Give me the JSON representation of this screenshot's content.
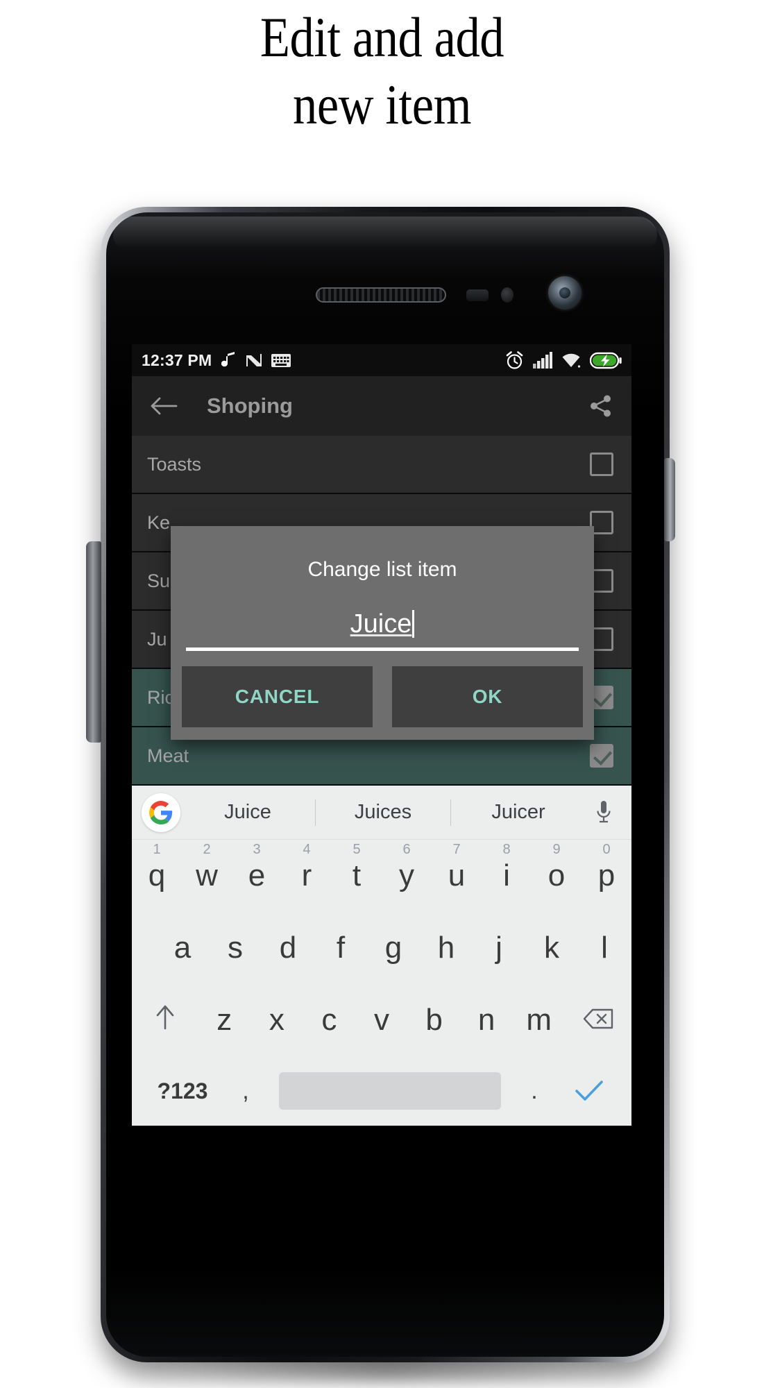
{
  "heading": {
    "line1": "Edit and add",
    "line2": "new item"
  },
  "status_bar": {
    "time": "12:37 PM",
    "left_icons": [
      "music-note-icon",
      "nougat-n-icon",
      "keyboard-icon"
    ],
    "right_icons": [
      "alarm-icon",
      "signal-bars-icon",
      "wifi-icon",
      "battery-charging-icon"
    ],
    "battery_color": "#3ea62b"
  },
  "app_bar": {
    "back_icon": "back-arrow-icon",
    "title": "Shoping",
    "share_icon": "share-icon"
  },
  "list": {
    "rows": [
      {
        "label": "Toasts",
        "checked": false,
        "done": false
      },
      {
        "label": "Ke",
        "checked": false,
        "done": false
      },
      {
        "label": "Su",
        "checked": false,
        "done": false
      },
      {
        "label": "Ju",
        "checked": false,
        "done": false
      },
      {
        "label": "Rice",
        "checked": true,
        "done": true
      },
      {
        "label": "Meat",
        "checked": true,
        "done": true
      }
    ]
  },
  "dialog": {
    "title": "Change list item",
    "input_value": "Juice",
    "cancel_label": "CANCEL",
    "ok_label": "OK",
    "accent_color": "#8fd7c4"
  },
  "keyboard": {
    "suggestions": [
      "Juice",
      "Juices",
      "Juicer"
    ],
    "google_icon": "google-g-icon",
    "mic_icon": "microphone-icon",
    "row1": [
      {
        "k": "q",
        "n": "1"
      },
      {
        "k": "w",
        "n": "2"
      },
      {
        "k": "e",
        "n": "3"
      },
      {
        "k": "r",
        "n": "4"
      },
      {
        "k": "t",
        "n": "5"
      },
      {
        "k": "y",
        "n": "6"
      },
      {
        "k": "u",
        "n": "7"
      },
      {
        "k": "i",
        "n": "8"
      },
      {
        "k": "o",
        "n": "9"
      },
      {
        "k": "p",
        "n": "0"
      }
    ],
    "row2": [
      "a",
      "s",
      "d",
      "f",
      "g",
      "h",
      "j",
      "k",
      "l"
    ],
    "row3": [
      "z",
      "x",
      "c",
      "v",
      "b",
      "n",
      "m"
    ],
    "shift_icon": "shift-arrow-icon",
    "backspace_icon": "backspace-icon",
    "symbols_label": "?123",
    "comma_label": ",",
    "period_label": ".",
    "enter_icon": "check-enter-icon",
    "enter_color": "#4a9fe0"
  }
}
